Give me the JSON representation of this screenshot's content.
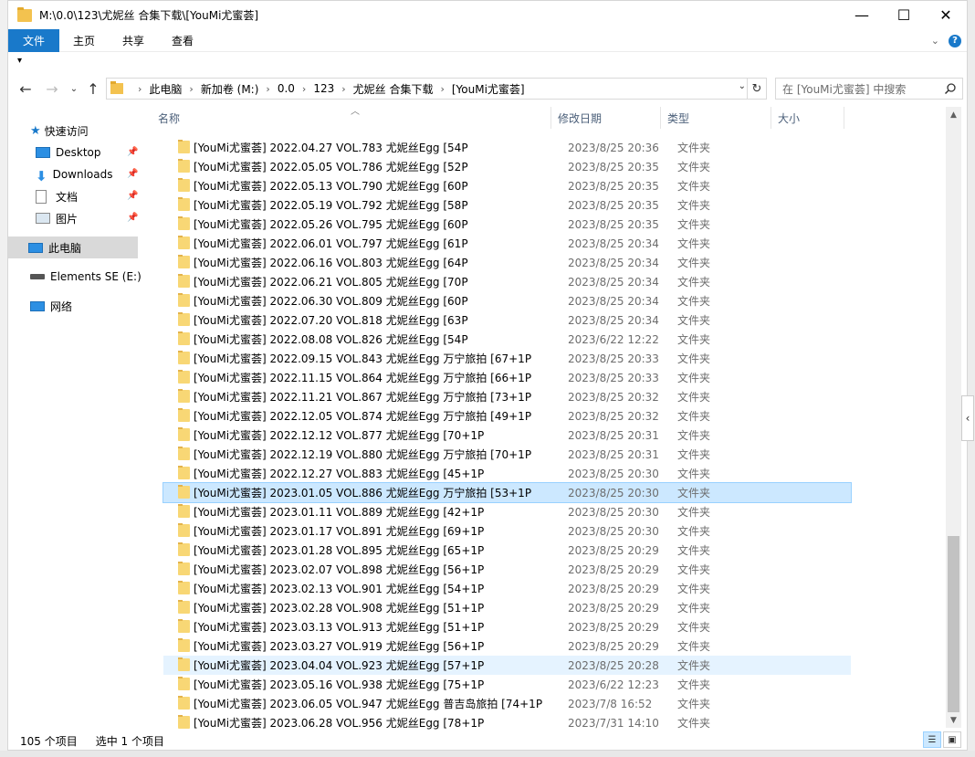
{
  "window": {
    "title": "M:\\0.0\\123\\尤妮丝 合集下载\\[YouMi尤蜜荟]",
    "controls": {
      "minimize": "—",
      "maximize": "☐",
      "close": "✕"
    }
  },
  "ribbon": {
    "tabs": [
      "文件",
      "主页",
      "共享",
      "查看"
    ],
    "expand_icon": "chevron-down-icon",
    "help_label": "?"
  },
  "qat_label": "▾",
  "address": {
    "crumbs": [
      "此电脑",
      "新加卷 (M:)",
      "0.0",
      "123",
      "尤妮丝 合集下载",
      "[YouMi尤蜜荟]"
    ],
    "search_placeholder": "在 [YouMi尤蜜荟] 中搜索"
  },
  "nav": {
    "quick_access": "快速访问",
    "items": [
      {
        "label": "Desktop",
        "icon": "desktop-icon",
        "pinned": true
      },
      {
        "label": "Downloads",
        "icon": "download-icon",
        "pinned": true
      },
      {
        "label": "文档",
        "icon": "document-icon",
        "pinned": true
      },
      {
        "label": "图片",
        "icon": "picture-icon",
        "pinned": true
      }
    ],
    "this_pc": "此电脑",
    "drive": "Elements SE (E:)",
    "network": "网络"
  },
  "columns": {
    "name": "名称",
    "date": "修改日期",
    "type": "类型",
    "size": "大小"
  },
  "files": [
    {
      "name": "[YouMi尤蜜荟] 2022.04.27 VOL.783 尤妮丝Egg [54P",
      "date": "2023/8/25 20:36",
      "type": "文件夹"
    },
    {
      "name": "[YouMi尤蜜荟] 2022.05.05 VOL.786 尤妮丝Egg [52P",
      "date": "2023/8/25 20:35",
      "type": "文件夹"
    },
    {
      "name": "[YouMi尤蜜荟] 2022.05.13 VOL.790 尤妮丝Egg [60P",
      "date": "2023/8/25 20:35",
      "type": "文件夹"
    },
    {
      "name": "[YouMi尤蜜荟] 2022.05.19 VOL.792 尤妮丝Egg [58P",
      "date": "2023/8/25 20:35",
      "type": "文件夹"
    },
    {
      "name": "[YouMi尤蜜荟] 2022.05.26 VOL.795 尤妮丝Egg  [60P",
      "date": "2023/8/25 20:35",
      "type": "文件夹"
    },
    {
      "name": "[YouMi尤蜜荟] 2022.06.01 VOL.797 尤妮丝Egg [61P",
      "date": "2023/8/25 20:34",
      "type": "文件夹"
    },
    {
      "name": "[YouMi尤蜜荟] 2022.06.16 VOL.803 尤妮丝Egg [64P",
      "date": "2023/8/25 20:34",
      "type": "文件夹"
    },
    {
      "name": "[YouMi尤蜜荟] 2022.06.21 VOL.805 尤妮丝Egg [70P",
      "date": "2023/8/25 20:34",
      "type": "文件夹"
    },
    {
      "name": "[YouMi尤蜜荟] 2022.06.30 VOL.809 尤妮丝Egg [60P",
      "date": "2023/8/25 20:34",
      "type": "文件夹"
    },
    {
      "name": "[YouMi尤蜜荟] 2022.07.20 VOL.818 尤妮丝Egg [63P",
      "date": "2023/8/25 20:34",
      "type": "文件夹"
    },
    {
      "name": "[YouMi尤蜜荟] 2022.08.08 VOL.826 尤妮丝Egg [54P",
      "date": "2023/6/22 12:22",
      "type": "文件夹"
    },
    {
      "name": "[YouMi尤蜜荟] 2022.09.15 VOL.843 尤妮丝Egg 万宁旅拍 [67+1P",
      "date": "2023/8/25 20:33",
      "type": "文件夹"
    },
    {
      "name": "[YouMi尤蜜荟] 2022.11.15 VOL.864 尤妮丝Egg 万宁旅拍 [66+1P",
      "date": "2023/8/25 20:33",
      "type": "文件夹"
    },
    {
      "name": "[YouMi尤蜜荟] 2022.11.21 VOL.867 尤妮丝Egg 万宁旅拍 [73+1P",
      "date": "2023/8/25 20:32",
      "type": "文件夹"
    },
    {
      "name": "[YouMi尤蜜荟] 2022.12.05 VOL.874 尤妮丝Egg 万宁旅拍 [49+1P",
      "date": "2023/8/25 20:32",
      "type": "文件夹"
    },
    {
      "name": "[YouMi尤蜜荟] 2022.12.12 VOL.877 尤妮丝Egg [70+1P",
      "date": "2023/8/25 20:31",
      "type": "文件夹"
    },
    {
      "name": "[YouMi尤蜜荟] 2022.12.19 VOL.880 尤妮丝Egg 万宁旅拍 [70+1P",
      "date": "2023/8/25 20:31",
      "type": "文件夹"
    },
    {
      "name": "[YouMi尤蜜荟] 2022.12.27 VOL.883 尤妮丝Egg [45+1P",
      "date": "2023/8/25 20:30",
      "type": "文件夹"
    },
    {
      "name": "[YouMi尤蜜荟] 2023.01.05 VOL.886 尤妮丝Egg 万宁旅拍 [53+1P",
      "date": "2023/8/25 20:30",
      "type": "文件夹",
      "selected": true
    },
    {
      "name": "[YouMi尤蜜荟] 2023.01.11 VOL.889 尤妮丝Egg [42+1P",
      "date": "2023/8/25 20:30",
      "type": "文件夹"
    },
    {
      "name": "[YouMi尤蜜荟] 2023.01.17 VOL.891 尤妮丝Egg [69+1P",
      "date": "2023/8/25 20:30",
      "type": "文件夹"
    },
    {
      "name": "[YouMi尤蜜荟] 2023.01.28 VOL.895 尤妮丝Egg [65+1P",
      "date": "2023/8/25 20:29",
      "type": "文件夹"
    },
    {
      "name": "[YouMi尤蜜荟] 2023.02.07 VOL.898 尤妮丝Egg [56+1P",
      "date": "2023/8/25 20:29",
      "type": "文件夹"
    },
    {
      "name": "[YouMi尤蜜荟] 2023.02.13 VOL.901 尤妮丝Egg [54+1P",
      "date": "2023/8/25 20:29",
      "type": "文件夹"
    },
    {
      "name": "[YouMi尤蜜荟] 2023.02.28 VOL.908 尤妮丝Egg [51+1P",
      "date": "2023/8/25 20:29",
      "type": "文件夹"
    },
    {
      "name": "[YouMi尤蜜荟] 2023.03.13 VOL.913 尤妮丝Egg [51+1P",
      "date": "2023/8/25 20:29",
      "type": "文件夹"
    },
    {
      "name": "[YouMi尤蜜荟] 2023.03.27 VOL.919 尤妮丝Egg [56+1P",
      "date": "2023/8/25 20:29",
      "type": "文件夹"
    },
    {
      "name": "[YouMi尤蜜荟] 2023.04.04 VOL.923 尤妮丝Egg [57+1P",
      "date": "2023/8/25 20:28",
      "type": "文件夹",
      "hover": true
    },
    {
      "name": "[YouMi尤蜜荟] 2023.05.16 VOL.938 尤妮丝Egg [75+1P",
      "date": "2023/6/22 12:23",
      "type": "文件夹"
    },
    {
      "name": "[YouMi尤蜜荟] 2023.06.05 VOL.947 尤妮丝Egg 普吉岛旅拍 [74+1P",
      "date": "2023/7/8 16:52",
      "type": "文件夹"
    },
    {
      "name": "[YouMi尤蜜荟] 2023.06.28 VOL.956 尤妮丝Egg [78+1P",
      "date": "2023/7/31 14:10",
      "type": "文件夹"
    }
  ],
  "status": {
    "count": "105 个项目",
    "selected": "选中 1 个项目"
  },
  "colors": {
    "accent": "#1979ca",
    "selection": "#cce8ff",
    "folder": "#f8d775"
  }
}
